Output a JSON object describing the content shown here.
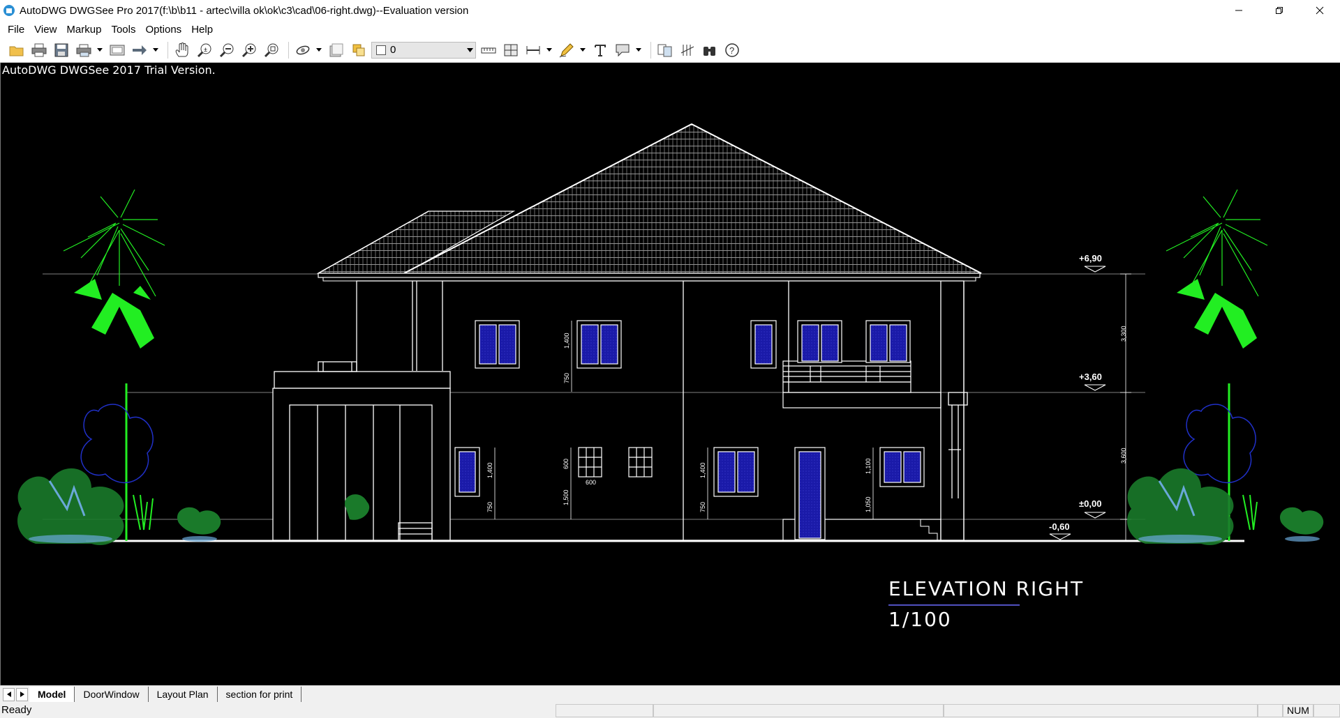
{
  "window": {
    "title": "AutoDWG DWGSee Pro 2017(f:\\b\\b11 - artec\\villa ok\\ok\\c3\\cad\\06-right.dwg)--Evaluation version"
  },
  "menu": [
    "File",
    "View",
    "Markup",
    "Tools",
    "Options",
    "Help"
  ],
  "toolbar": {
    "layer_value": "0",
    "icons": [
      "open-icon",
      "print-icon",
      "save-icon",
      "batch-print-icon",
      "page-setup-icon",
      "convert-icon",
      "pan-icon",
      "zoom-realtime-icon",
      "zoom-out-icon",
      "zoom-in-icon",
      "zoom-window-icon",
      "orbit-icon",
      "layer-icon",
      "measure-distance-icon",
      "measure-area-icon",
      "dimension-icon",
      "pen-icon",
      "text-icon",
      "cloud-markup-icon",
      "compare-icon",
      "hatch-icon",
      "find-icon",
      "help-icon"
    ]
  },
  "canvas": {
    "trial_text": "AutoDWG DWGSee 2017 Trial Version.",
    "background": "#000000"
  },
  "drawing": {
    "level_top": "+6,90",
    "level_mid": "+3,60",
    "level_ground": "±0,00",
    "level_below": "-0,60",
    "dim_upper": "3,300",
    "dim_lower": "3,600",
    "win_h1": "1,400",
    "win_s1": "750",
    "win_h2": "1,400",
    "win_s2": "750",
    "win_h3": "600",
    "win_s3": "1,500",
    "win_w3": "600",
    "win_h4": "1,400",
    "win_s4": "750",
    "win_h5": "1,100",
    "win_s5": "1,050",
    "title_main": "ELEVATION RIGHT",
    "title_scale": "1/100",
    "colors": {
      "line": "#ffffff",
      "glass": "#1a1aa8",
      "palm": "#22ee22",
      "shrub": "#1a7a2a",
      "tree_outline": "#2030c8",
      "water": "#6aa8d8"
    }
  },
  "tabs": [
    "Model",
    "DoorWindow",
    "Layout Plan",
    "section for print"
  ],
  "active_tab": "Model",
  "status": {
    "text": "Ready",
    "num": "NUM"
  }
}
